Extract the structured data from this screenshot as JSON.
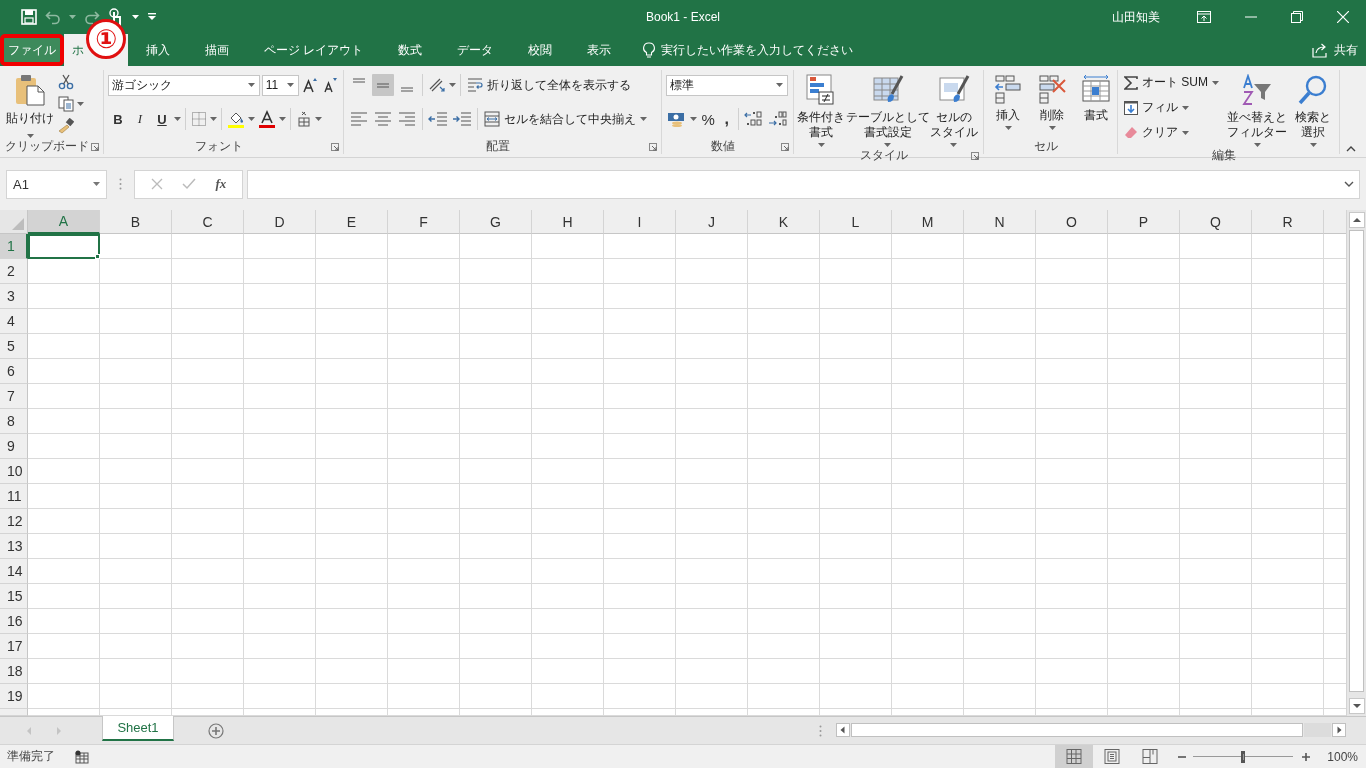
{
  "window": {
    "title": "Book1  -  Excel",
    "user": "山田知美"
  },
  "tabs": [
    {
      "label": "ファイル",
      "kind": "file",
      "selected": false,
      "highlighted": true
    },
    {
      "label": "ホ",
      "kind": "tab",
      "selected": true,
      "highlighted": false
    },
    {
      "label": "挿入",
      "kind": "tab",
      "selected": false,
      "highlighted": false
    },
    {
      "label": "描画",
      "kind": "tab",
      "selected": false,
      "highlighted": false
    },
    {
      "label": "ページ レイアウト",
      "kind": "tab",
      "selected": false,
      "highlighted": false
    },
    {
      "label": "数式",
      "kind": "tab",
      "selected": false,
      "highlighted": false
    },
    {
      "label": "データ",
      "kind": "tab",
      "selected": false,
      "highlighted": false
    },
    {
      "label": "校閲",
      "kind": "tab",
      "selected": false,
      "highlighted": false
    },
    {
      "label": "表示",
      "kind": "tab",
      "selected": false,
      "highlighted": false
    }
  ],
  "annotation": {
    "label": "①"
  },
  "tell_me": {
    "placeholder": "実行したい作業を入力してください"
  },
  "share": "共有",
  "ribbon": {
    "clipboard": {
      "label": "クリップボード",
      "paste": "貼り付け"
    },
    "font": {
      "label": "フォント",
      "font_name": "游ゴシック",
      "font_size": "11",
      "bold": "B",
      "italic": "I",
      "underline": "U"
    },
    "alignment": {
      "label": "配置",
      "wrap_text": "折り返して全体を表示する",
      "merge": "セルを結合して中央揃え",
      "vertical_align": [
        {
          "selected": false
        },
        {
          "selected": true
        },
        {
          "selected": false
        }
      ]
    },
    "number": {
      "label": "数値",
      "format": "標準",
      "percent": "%",
      "comma": ","
    },
    "styles": {
      "label": "スタイル",
      "buttons": [
        [
          "条件付き",
          "書式"
        ],
        [
          "テーブルとして",
          "書式設定"
        ],
        [
          "セルの",
          "スタイル"
        ]
      ]
    },
    "cells": {
      "label": "セル",
      "buttons": [
        "挿入",
        "削除",
        "書式"
      ]
    },
    "editing": {
      "label": "編集",
      "autosum": "オート SUM",
      "fill": "フィル",
      "clear": "クリア",
      "sort": [
        "並べ替えと",
        "フィルター"
      ],
      "find": [
        "検索と",
        "選択"
      ]
    }
  },
  "formula_bar": {
    "name_box": "A1",
    "function_label": "fx"
  },
  "sheet": {
    "columns": [
      {
        "label": "A",
        "selected": true
      },
      {
        "label": "B",
        "selected": false
      },
      {
        "label": "C",
        "selected": false
      },
      {
        "label": "D",
        "selected": false
      },
      {
        "label": "E",
        "selected": false
      },
      {
        "label": "F",
        "selected": false
      },
      {
        "label": "G",
        "selected": false
      },
      {
        "label": "H",
        "selected": false
      },
      {
        "label": "I",
        "selected": false
      },
      {
        "label": "J",
        "selected": false
      },
      {
        "label": "K",
        "selected": false
      },
      {
        "label": "L",
        "selected": false
      },
      {
        "label": "M",
        "selected": false
      },
      {
        "label": "N",
        "selected": false
      },
      {
        "label": "O",
        "selected": false
      },
      {
        "label": "P",
        "selected": false
      },
      {
        "label": "Q",
        "selected": false
      },
      {
        "label": "R",
        "selected": false
      }
    ],
    "rows": [
      {
        "label": "1",
        "selected": true
      },
      {
        "label": "2",
        "selected": false
      },
      {
        "label": "3",
        "selected": false
      },
      {
        "label": "4",
        "selected": false
      },
      {
        "label": "5",
        "selected": false
      },
      {
        "label": "6",
        "selected": false
      },
      {
        "label": "7",
        "selected": false
      },
      {
        "label": "8",
        "selected": false
      },
      {
        "label": "9",
        "selected": false
      },
      {
        "label": "10",
        "selected": false
      },
      {
        "label": "11",
        "selected": false
      },
      {
        "label": "12",
        "selected": false
      },
      {
        "label": "13",
        "selected": false
      },
      {
        "label": "14",
        "selected": false
      },
      {
        "label": "15",
        "selected": false
      },
      {
        "label": "16",
        "selected": false
      },
      {
        "label": "17",
        "selected": false
      },
      {
        "label": "18",
        "selected": false
      },
      {
        "label": "19",
        "selected": false
      }
    ]
  },
  "sheet_tabs": [
    {
      "label": "Sheet1",
      "selected": true
    }
  ],
  "status_bar": {
    "status": "準備完了",
    "views": [
      {
        "kind": "normal",
        "selected": true
      },
      {
        "kind": "page_layout",
        "selected": false
      },
      {
        "kind": "page_break",
        "selected": false
      }
    ],
    "zoom": {
      "level": 0.5,
      "reading": "100%"
    }
  }
}
